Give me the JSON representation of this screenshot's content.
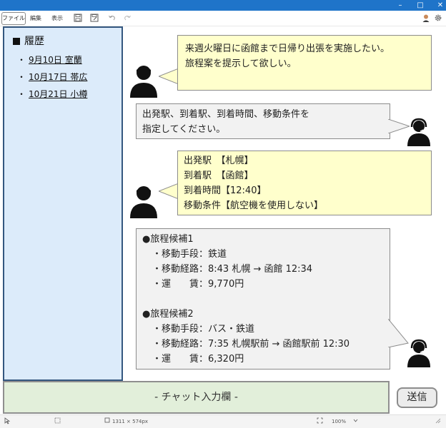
{
  "window": {
    "controls": {
      "minimize": "–",
      "maximize": "□",
      "close": "✕"
    }
  },
  "toolbar": {
    "file_label": "ファイル",
    "edit_label": "編集",
    "view_label": "表示",
    "icons": [
      "save-icon",
      "save-as-icon",
      "undo-icon",
      "redo-icon",
      "user-icon",
      "gear-icon"
    ]
  },
  "sidebar": {
    "title": "履歴",
    "items": [
      {
        "bullet": "・",
        "label": "9月10日 室蘭"
      },
      {
        "bullet": "・",
        "label": "10月17日 帯広"
      },
      {
        "bullet": "・",
        "label": "10月21日 小樽"
      }
    ]
  },
  "chat": {
    "messages": [
      {
        "role": "user",
        "lines": [
          "来週火曜日に函館まで日帰り出張を実施したい。",
          "旅程案を提示して欲しい。"
        ]
      },
      {
        "role": "assistant",
        "lines": [
          "出発駅、到着駅、到着時間、移動条件を",
          "指定してください。"
        ]
      },
      {
        "role": "user",
        "lines": [
          "出発駅　【札幌】",
          "到着駅　【函館】",
          "到着時間【12:40】",
          "移動条件【航空機を使用しない】"
        ]
      },
      {
        "role": "assistant",
        "lines": [
          "●旅程候補1",
          "・移動手段：鉄道",
          "・移動経路：8:43 札幌 → 函館 12:34",
          "・運　　賃：9,770円",
          "",
          "●旅程候補2",
          "・移動手段：バス・鉄道",
          "・移動経路：7:35 札幌駅前 → 函館駅前 12:30",
          "・運　　賃：6,320円"
        ]
      }
    ]
  },
  "input": {
    "placeholder": "- チャット入力欄 -"
  },
  "send_button": {
    "label": "送信"
  },
  "statusbar": {
    "dimensions": "1311 × 574px",
    "zoom": "100%"
  },
  "colors": {
    "titlebar": "#1f74c9",
    "sidebar_bg": "#dcebfa",
    "sidebar_border": "#34577f",
    "user_bubble": "#ffffcc",
    "bot_bubble": "#f2f2f2",
    "input_bg": "#e2efda"
  }
}
